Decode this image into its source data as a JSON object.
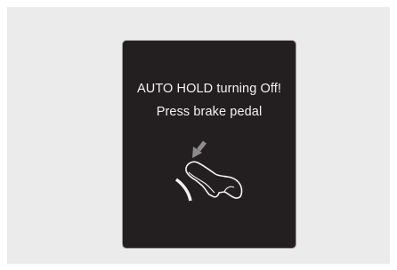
{
  "display": {
    "message_line1": "AUTO HOLD turning Off!",
    "message_line2": "Press brake pedal",
    "background_color": "#231f20",
    "text_color": "#f2f2f2",
    "arrow_color": "#8c8c8c"
  },
  "icons": {
    "pictogram": "foot-pressing-brake-pedal-icon",
    "arrow": "press-down-arrow-icon"
  }
}
